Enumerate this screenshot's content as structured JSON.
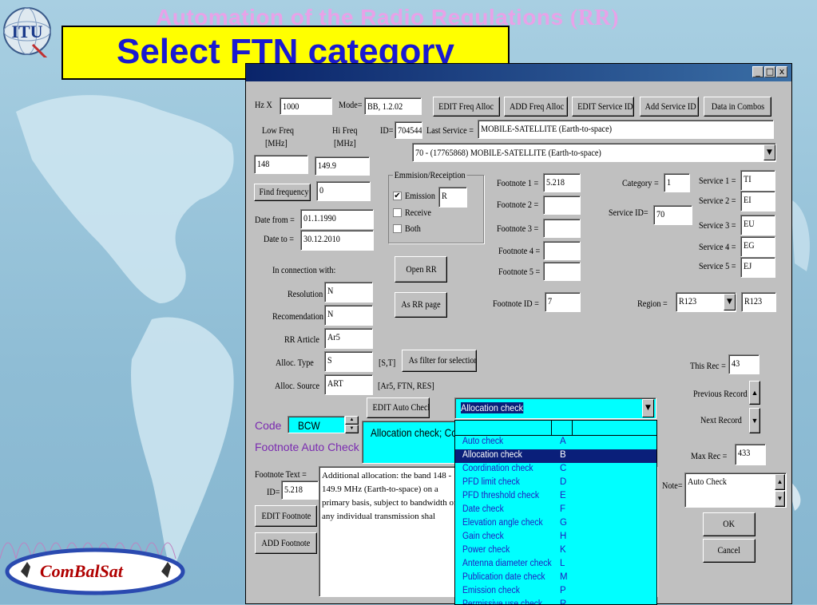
{
  "slide": {
    "title_main": "Automation of the Radio Regulations ",
    "title_rr": "(RR)",
    "callout": "Select FTN category",
    "logo_text": "ITU",
    "brand": "ComBalSat"
  },
  "window": {
    "controls": [
      "_",
      "□",
      "x"
    ]
  },
  "form": {
    "hz_label": "Hz X",
    "hz_value": "1000",
    "mode_label": "Mode=",
    "mode_value": "BB, 1.2.02",
    "buttons": {
      "edit_freq_alloc": "EDIT Freq Alloc",
      "add_freq_alloc": "ADD Freq Alloc",
      "edit_service_id": "EDIT Service ID",
      "add_service_id": "Add Service ID",
      "data_in_combos": "Data in Combos",
      "find_frequency": "Find frequency",
      "open_rr": "Open RR",
      "as_rr_page": "As RR page",
      "as_filter": "As filter for selection",
      "edit_auto_check": "EDIT Auto Check",
      "edit_footnote": "EDIT Footnote",
      "add_footnote": "ADD Footnote",
      "ok": "OK",
      "cancel": "Cancel"
    },
    "low_freq_label": "Low Freq",
    "low_freq_unit": "[MHz]",
    "hi_freq_label": "Hi Freq",
    "hi_freq_unit": "[MHz]",
    "low_freq": "148",
    "hi_freq": "149.9",
    "id_label": "ID=",
    "id_value": "704544",
    "last_service_label": "Last Service =",
    "last_service_value": "MOBILE-SATELLITE (Earth-to-space)",
    "service_combo": "70 - (17765868) MOBILE-SATELLITE (Earth-to-space)",
    "find_value": "0",
    "date_from_label": "Date from =",
    "date_from": "01.1.1990",
    "date_to_label": "Date to =",
    "date_to": "30.12.2010",
    "emission_group": "Emmision/Receiption",
    "emission_label": "Emission",
    "emission_checked": "✔",
    "emission_value": "R",
    "receive_label": "Receive",
    "both_label": "Both",
    "footnotes": [
      {
        "label": "Footnote 1 =",
        "value": "5.218"
      },
      {
        "label": "Footnote 2 =",
        "value": ""
      },
      {
        "label": "Footnote 3 =",
        "value": ""
      },
      {
        "label": "Footnote 4 =",
        "value": ""
      },
      {
        "label": "Footnote 5 =",
        "value": ""
      }
    ],
    "footnote_id_label": "Footnote ID =",
    "footnote_id": "7",
    "category_label": "Category =",
    "category": "1",
    "service_id_label": "Service ID=",
    "service_id": "70",
    "services": [
      {
        "label": "Service 1 =",
        "value": "TI"
      },
      {
        "label": "Service 2 =",
        "value": "EI"
      },
      {
        "label": "Service 3 =",
        "value": "EU"
      },
      {
        "label": "Service 4 =",
        "value": "EG"
      },
      {
        "label": "Service 5 =",
        "value": "EJ"
      }
    ],
    "region_label": "Region =",
    "region_select": "R123",
    "region_value": "R123",
    "in_connection_label": "In connection with:",
    "resolution_label": "Resolution",
    "resolution": "N",
    "recommendation_label": "Recomendation",
    "recommendation": "N",
    "rr_article_label": "RR Article",
    "rr_article": "Ar5",
    "alloc_type_label": "Alloc. Type",
    "alloc_type": "S",
    "alloc_type_hint": "[S,T]",
    "alloc_source_label": "Alloc. Source",
    "alloc_source": "ART",
    "alloc_source_hint": "[Ar5, FTN, RES]",
    "this_rec_label": "This Rec =",
    "this_rec": "43",
    "previous_record": "Previous Record",
    "next_record": "Next Record",
    "max_rec_label": "Max Rec =",
    "max_rec": "433",
    "note_label": "Note=",
    "note_value": "Auto Check",
    "code_label": "Code",
    "code_value": "BCW",
    "auto_check_label": "Footnote Auto Check =",
    "auto_check_value": "Allocation check; Co",
    "footnote_text_label": "Footnote Text =",
    "ft_id_label": "ID=",
    "ft_id": "5.218",
    "footnote_text": "Additional allocation: the band 148 - 149.9 MHz (Earth-to-space) on a primary basis, subject to bandwidth of any individual transmission shal"
  },
  "dropdown": {
    "selected": "Allocation check",
    "items": [
      {
        "name": "Auto check",
        "code": "A"
      },
      {
        "name": "Allocation check",
        "code": "B",
        "selected": true
      },
      {
        "name": "Coordination check",
        "code": "C"
      },
      {
        "name": "PFD limit check",
        "code": "D"
      },
      {
        "name": "PFD threshold check",
        "code": "E"
      },
      {
        "name": "Date check",
        "code": "F"
      },
      {
        "name": "Elevation angle check",
        "code": "G"
      },
      {
        "name": "Gain check",
        "code": "H"
      },
      {
        "name": "Power check",
        "code": "K"
      },
      {
        "name": "Antenna diameter check",
        "code": "L"
      },
      {
        "name": "Publication date check",
        "code": "M"
      },
      {
        "name": "Emission check",
        "code": "P"
      },
      {
        "name": "Permissive use check",
        "code": "R"
      }
    ]
  },
  "colors": {
    "callout_bg": "#ffff00",
    "callout_text": "#1a1ad0",
    "title_pink": "#e8a2e8",
    "dropdown_bg": "#00ffff",
    "dropdown_selected": "#0a1f7a"
  }
}
